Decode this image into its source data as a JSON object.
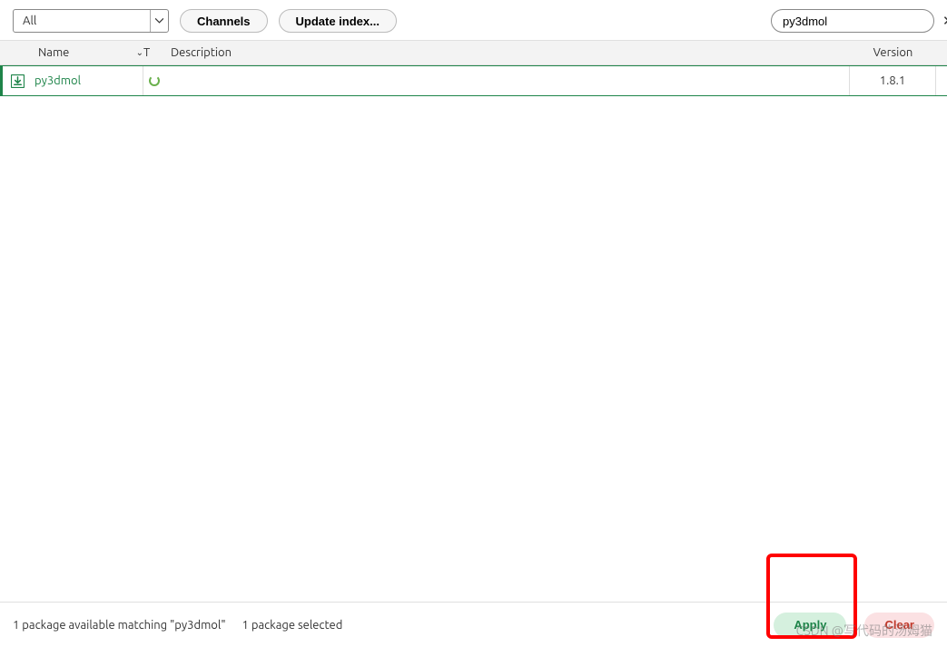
{
  "toolbar": {
    "filter_value": "All",
    "channels_label": "Channels",
    "update_index_label": "Update index..."
  },
  "search": {
    "value": "py3dmol"
  },
  "columns": {
    "name": "Name",
    "t": "T",
    "description": "Description",
    "version": "Version"
  },
  "rows": [
    {
      "name": "py3dmol",
      "version": "1.8.1"
    }
  ],
  "footer": {
    "available": "1 package available matching \"py3dmol\"",
    "selected": "1 package selected",
    "apply_label": "Apply",
    "clear_label": "Clear"
  },
  "watermark": "CSDN @写代码的汤姆猫"
}
